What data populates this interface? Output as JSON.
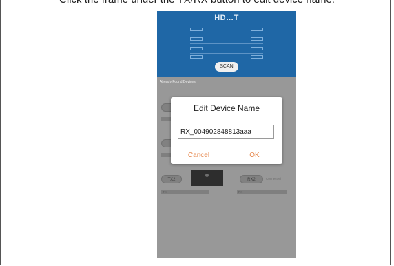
{
  "instruction": "Click the frame under the TX/RX button to edit device name.",
  "app": {
    "logo": "HD…T",
    "scan_label": "SCAN",
    "section_label": "Already Found Devices"
  },
  "devices": {
    "row3": {
      "tx_label": "TX2",
      "rx_label": "RX2",
      "rx_status": "Connected",
      "tx_name": "TX",
      "rx_name": "RX"
    }
  },
  "dialog": {
    "title": "Edit Device Name",
    "input_value": "RX_004902848813aaa",
    "cancel_label": "Cancel",
    "ok_label": "OK"
  },
  "colors": {
    "header": "#1f67a6",
    "accent": "#e6874c"
  }
}
